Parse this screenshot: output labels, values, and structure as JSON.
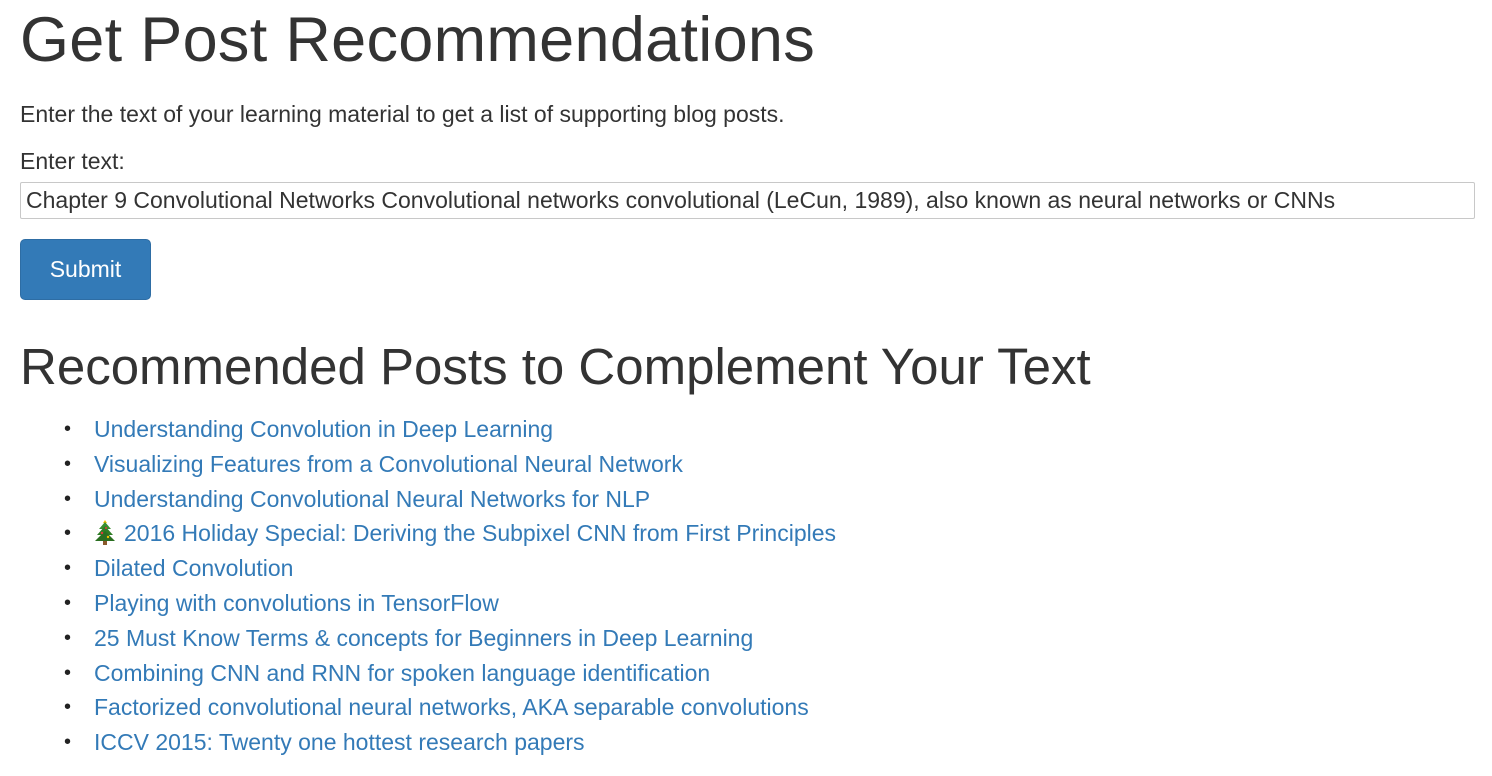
{
  "header": {
    "title": "Get Post Recommendations",
    "lead": "Enter the text of your learning material to get a list of supporting blog posts."
  },
  "form": {
    "label": "Enter text:",
    "input_value": "Chapter 9 Convolutional Networks Convolutional networks convolutional (LeCun, 1989), also known as neural networks or CNNs",
    "submit_label": "Submit"
  },
  "results": {
    "heading": "Recommended Posts to Complement Your Text",
    "posts": [
      {
        "label": "Understanding Convolution in Deep Learning"
      },
      {
        "label": "Visualizing Features from a Convolutional Neural Network"
      },
      {
        "label": "Understanding Convolutional Neural Networks for NLP"
      },
      {
        "label": "2016 Holiday Special: Deriving the Subpixel CNN from First Principles",
        "icon": "christmas-tree-icon"
      },
      {
        "label": "Dilated Convolution"
      },
      {
        "label": "Playing with convolutions in TensorFlow"
      },
      {
        "label": "25 Must Know Terms & concepts for Beginners in Deep Learning"
      },
      {
        "label": "Combining CNN and RNN for spoken language identification"
      },
      {
        "label": "Factorized convolutional neural networks, AKA separable convolutions"
      },
      {
        "label": "ICCV 2015: Twenty one hottest research papers"
      }
    ]
  },
  "colors": {
    "link": "#337ab7",
    "button": "#337ab7",
    "text": "#333333"
  }
}
